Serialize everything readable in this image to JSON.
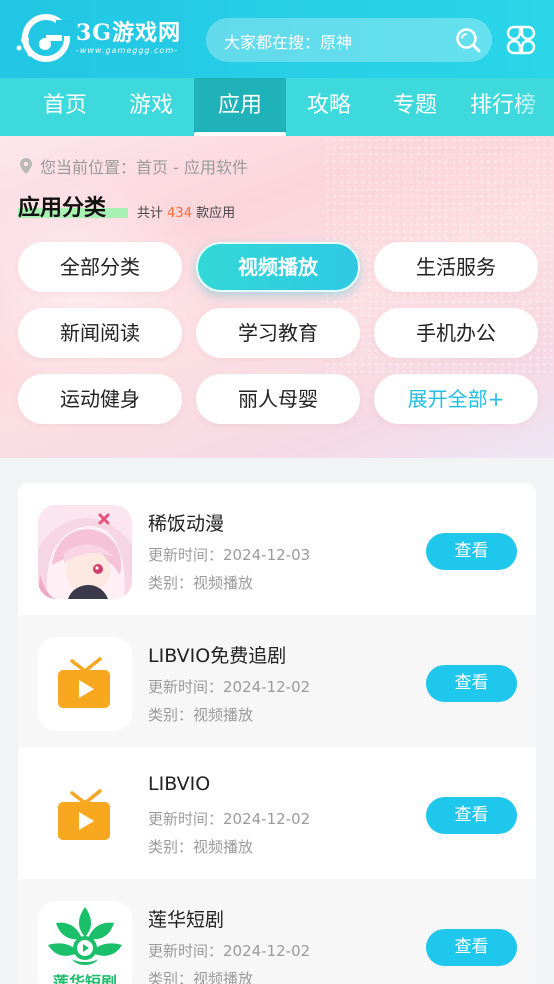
{
  "header": {
    "logo_title": "3G游戏网",
    "logo_sub": "-www.gameggg.com-",
    "search_placeholder": "大家都在搜：原神",
    "colors": {
      "primary": "#22c6e4",
      "nav": "#3dd9dc",
      "nav_active": "#1fb2b9"
    }
  },
  "nav": {
    "items": [
      {
        "label": "首页"
      },
      {
        "label": "游戏"
      },
      {
        "label": "应用"
      },
      {
        "label": "攻略"
      },
      {
        "label": "专题"
      },
      {
        "label": "排行榜"
      }
    ],
    "active_index": 2
  },
  "category": {
    "breadcrumb": "您当前位置：首页 - 应用软件",
    "title": "应用分类",
    "count_prefix": "共计",
    "count": "434",
    "count_suffix": "款应用",
    "pills": [
      {
        "label": "全部分类"
      },
      {
        "label": "视频播放"
      },
      {
        "label": "生活服务"
      },
      {
        "label": "新闻阅读"
      },
      {
        "label": "学习教育"
      },
      {
        "label": "手机办公"
      },
      {
        "label": "运动健身"
      },
      {
        "label": "丽人母婴"
      },
      {
        "label": "展开全部+"
      }
    ],
    "active_index": 1,
    "accent": "#ff6a2b"
  },
  "apps": [
    {
      "name": "稀饭动漫",
      "date": "更新时间：2024-12-03",
      "category": "类别：视频播放",
      "button": "查看",
      "icon": "anime-girl-icon"
    },
    {
      "name": "LIBVIO免费追剧",
      "date": "更新时间：2024-12-02",
      "category": "类别：视频播放",
      "button": "查看",
      "icon": "tv-play-icon"
    },
    {
      "name": "LIBVIO",
      "date": "更新时间：2024-12-02",
      "category": "类别：视频播放",
      "button": "查看",
      "icon": "tv-play-icon"
    },
    {
      "name": "莲华短剧",
      "date": "更新时间：2024-12-02",
      "category": "类别：视频播放",
      "button": "查看",
      "icon": "lotus-play-icon",
      "icon_text": "莲华短剧"
    }
  ]
}
